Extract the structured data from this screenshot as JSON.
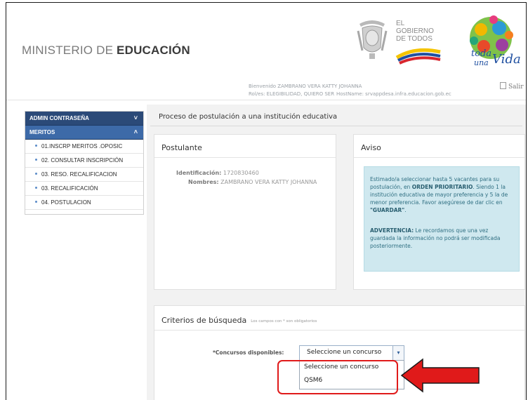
{
  "header": {
    "ministry_light": "MINISTERIO DE ",
    "ministry_bold": "EDUCACIÓN",
    "gob_line1": "EL",
    "gob_line2": "GOBIERNO",
    "gob_line3": "DE TODOS",
    "vida_script": "Toda una Vida",
    "welcome_line1": "Bienvenido ZAMBRANO VERA KATTY JOHANNA",
    "welcome_line2": "Rol/es: ELEGIBILIDAD, QUIERO SER",
    "hostname": "HostName: srvappdesa.infra.educacion.gob.ec",
    "salir": "Salir"
  },
  "sidebar": {
    "sections": [
      {
        "label": "ADMIN CONTRASEÑA",
        "chevron": "˅"
      },
      {
        "label": "MERITOS",
        "chevron": "˄"
      }
    ],
    "items": [
      {
        "label": "01.INSCRP MERITOS .OPOSIC"
      },
      {
        "label": "02. CONSULTAR INSCRIPCIÓN"
      },
      {
        "label": "03. RESO. RECALIFICACION"
      },
      {
        "label": "03. RECALIFICACIÓN"
      },
      {
        "label": "04. POSTULACION"
      }
    ]
  },
  "main": {
    "page_title": "Proceso de postulación a una institución educativa",
    "postulante": {
      "title": "Postulante",
      "id_label": "Identificación:",
      "id_value": "1720830460",
      "name_label": "Nombres:",
      "name_value": "ZAMBRANO VERA KATTY JOHANNA"
    },
    "aviso": {
      "title": "Aviso",
      "p1_a": "Estimado/a seleccionar hasta 5 vacantes para su postulación, en ",
      "p1_b": "ORDEN PRIORITARIO",
      "p1_c": ". Siendo 1 la institución educativa de mayor preferencia y 5 la de menor preferencia. Favor asegúrese de dar clic en ",
      "p1_d": "\"GUARDAR\"",
      "p1_e": ".",
      "p2_a": "ADVERTENCIA:",
      "p2_b": " Le recordamos que una vez guardada la información no podrá ser modificada posteriormente."
    },
    "criterios": {
      "title": "Criterios de búsqueda",
      "note": "Los campos con * son obligatorios",
      "field_label": "*Concursos disponibles:",
      "selected": "Seleccione un concurso",
      "options": [
        "Seleccione un concurso",
        "QSM6"
      ]
    }
  },
  "colors": {
    "sidebar_header": "#2b4a78",
    "sidebar_active": "#3d6aa8",
    "alert_bg": "#cfe8ef",
    "highlight": "#e01a1a",
    "arrow": "#e01a1a"
  }
}
